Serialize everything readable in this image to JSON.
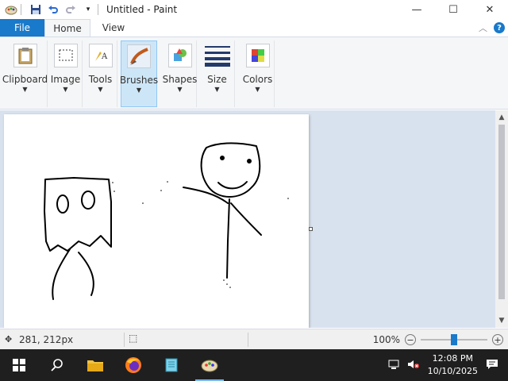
{
  "window": {
    "title": "Untitled - Paint",
    "controls": {
      "minimize": "—",
      "maximize": "☐",
      "close": "✕"
    }
  },
  "tabs": {
    "file": "File",
    "items": [
      "Home",
      "View"
    ],
    "active": "Home"
  },
  "ribbon": {
    "groups": [
      {
        "label": "Clipboard",
        "icon": "clipboard-icon"
      },
      {
        "label": "Image",
        "icon": "image-select-icon"
      },
      {
        "label": "Tools",
        "icon": "tools-icon"
      },
      {
        "label": "Brushes",
        "icon": "brushes-icon",
        "selected": true
      },
      {
        "label": "Shapes",
        "icon": "shapes-icon"
      },
      {
        "label": "Size",
        "icon": "size-icon"
      },
      {
        "label": "Colors",
        "icon": "colors-icon"
      }
    ]
  },
  "status": {
    "coords": "281, 212px",
    "zoom": "100%",
    "zoom_level": 0.5
  },
  "taskbar": {
    "time": "12:08 PM",
    "date": "10/10/2025",
    "apps": [
      "start-icon",
      "search-icon",
      "file-explorer-icon",
      "firefox-icon",
      "notepad-icon",
      "paint-icon"
    ]
  },
  "colors": {
    "accent": "#1979ca",
    "workspace": "#d8e2ef",
    "taskbar": "#1f1f1f"
  }
}
